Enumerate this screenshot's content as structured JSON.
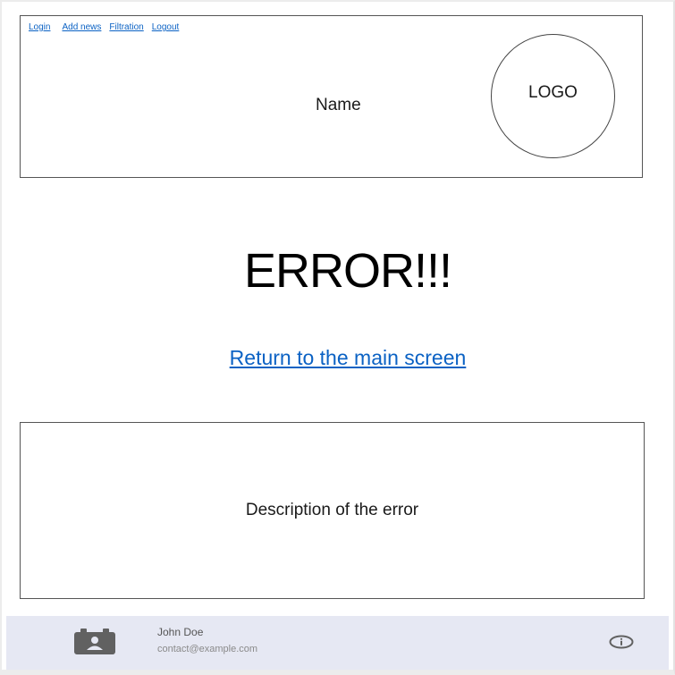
{
  "nav": {
    "items": [
      "Login",
      "Add news",
      "Filtration",
      "Logout"
    ]
  },
  "header": {
    "site_name": "Name",
    "logo_text": "LOGO"
  },
  "main": {
    "error_title": "ERROR!!!",
    "return_link": "Return to the main screen",
    "description": "Description of the error"
  },
  "footer": {
    "user_name": "John Doe",
    "user_email": "contact@example.com",
    "contact_icon": "contact-card-icon",
    "info_icon": "info-icon"
  },
  "colors": {
    "link": "#0b62c4",
    "footer_bg": "#e6e8f3",
    "icon_gray": "#616161"
  }
}
